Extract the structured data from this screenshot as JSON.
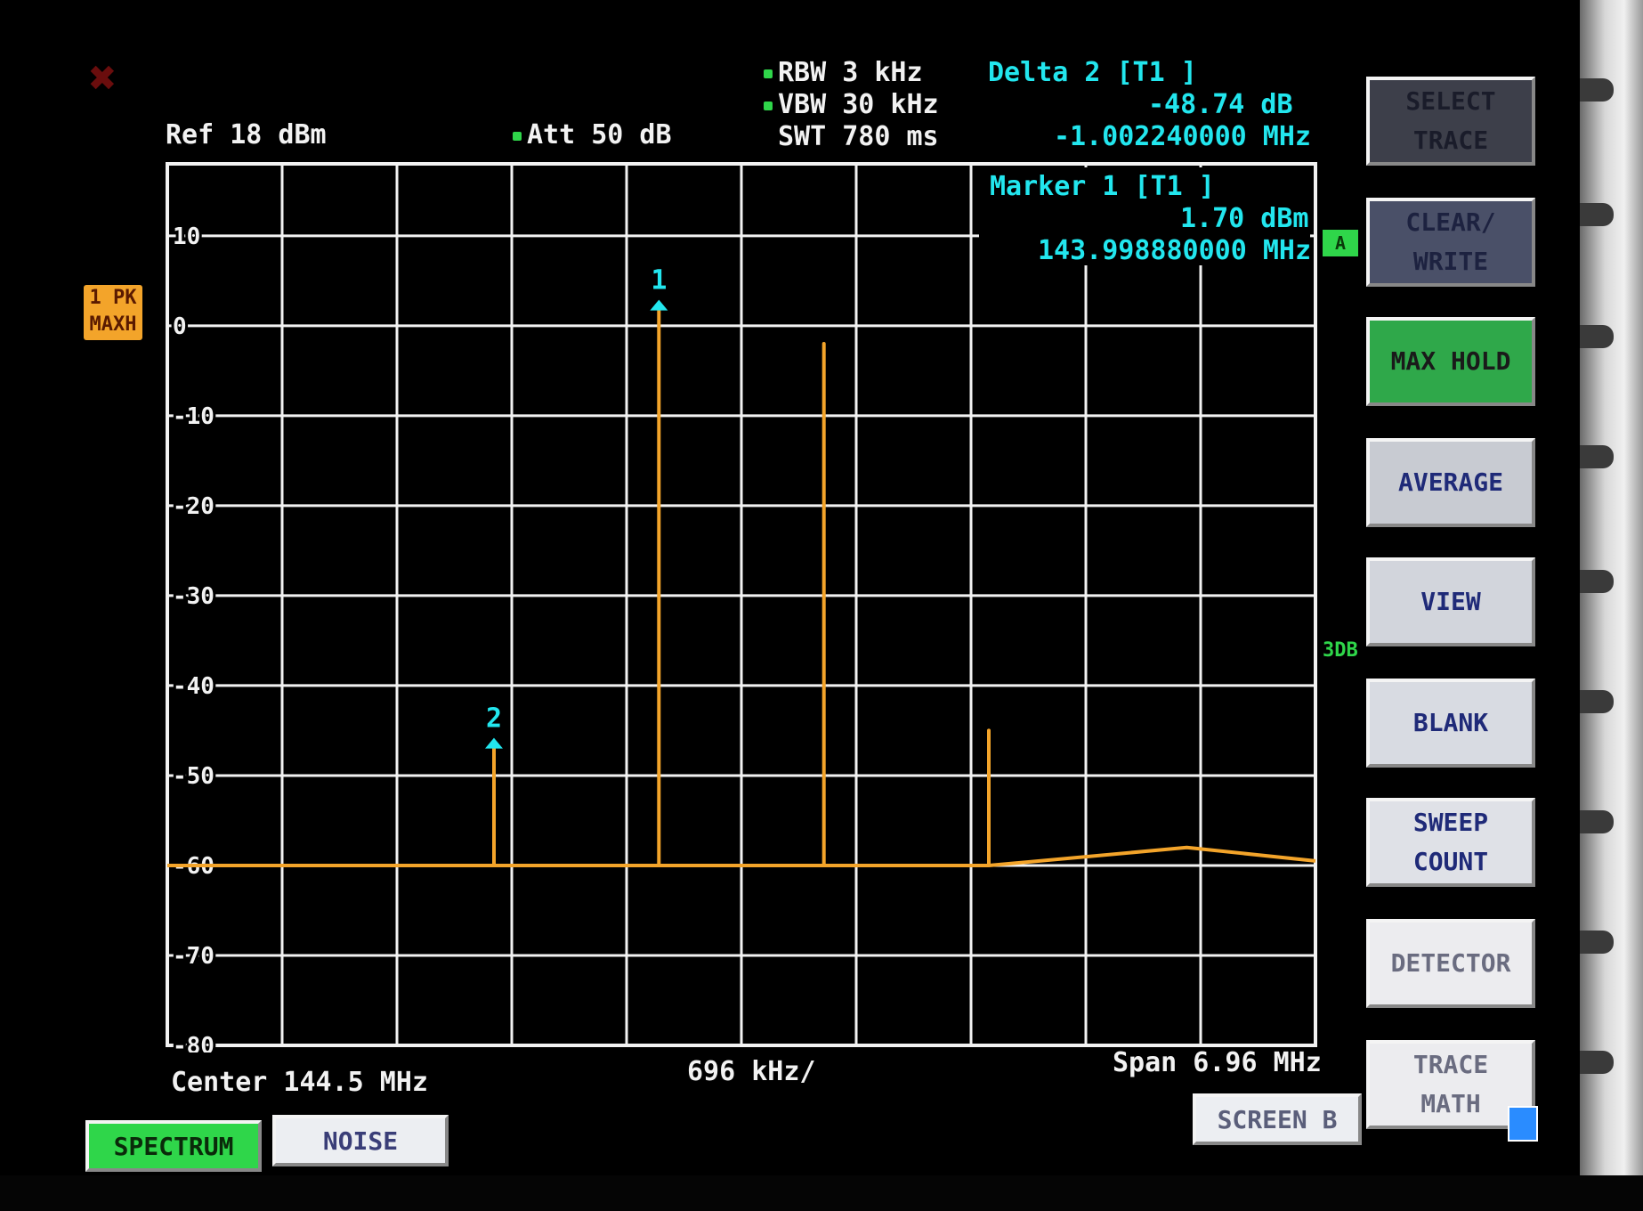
{
  "header": {
    "ref": "Ref  18 dBm",
    "att": "Att  50 dB",
    "rbw": "RBW 3 kHz",
    "vbw": "VBW 30 kHz",
    "swt": "SWT 780 ms"
  },
  "delta_marker": {
    "title": "Delta 2 [T1 ]",
    "level": "-48.74 dB",
    "freq": "-1.002240000 MHz"
  },
  "marker1": {
    "title": "Marker 1 [T1 ]",
    "level": "1.70 dBm",
    "freq": "143.998880000 MHz"
  },
  "chart_data": {
    "type": "line",
    "title": "",
    "xlabel": "",
    "ylabel": "",
    "ylim": [
      -80,
      18
    ],
    "yticks": [
      "10",
      "0",
      "-10",
      "-20",
      "-30",
      "-40",
      "-50",
      "-60",
      "-70",
      "-80"
    ],
    "grid": true,
    "x_axis": {
      "center": "Center 144.5 MHz",
      "per_div": "696 kHz/",
      "span": "Span 6.96 MHz",
      "range_mhz": [
        141.02,
        147.98
      ]
    },
    "series": [
      {
        "x": [
          141.02,
          142.0,
          143.0,
          143.0,
          143.0,
          144.0,
          144.0,
          144.0,
          145.0,
          145.0,
          145.0,
          146.0,
          146.0,
          146.0,
          147.2,
          147.98
        ],
        "y": [
          -60,
          -60,
          -60,
          -47,
          -60,
          -60,
          1.7,
          -60,
          -60,
          -2,
          -60,
          -60,
          -45,
          -60,
          -58,
          -59.5
        ]
      }
    ],
    "markers": [
      {
        "label": "1",
        "x": 144.0,
        "y": 1.7
      },
      {
        "label": "2",
        "x": 143.0,
        "y": -47
      }
    ]
  },
  "trace_badge": {
    "line1": "1 PK",
    "line2": "MAXH"
  },
  "side_badges": {
    "a": "A",
    "three_db": "3DB"
  },
  "softkeys": [
    {
      "line1": "SELECT",
      "line2": "TRACE"
    },
    {
      "line1": "CLEAR/",
      "line2": "WRITE"
    },
    {
      "line1": "MAX HOLD",
      "line2": ""
    },
    {
      "line1": "AVERAGE",
      "line2": ""
    },
    {
      "line1": "VIEW",
      "line2": ""
    },
    {
      "line1": "BLANK",
      "line2": ""
    },
    {
      "line1": "SWEEP",
      "line2": "COUNT"
    },
    {
      "line1": "DETECTOR",
      "line2": ""
    },
    {
      "line1": "TRACE",
      "line2": "MATH"
    }
  ],
  "tabs": {
    "spectrum": "SPECTRUM",
    "noise": "NOISE",
    "screen_b": "SCREEN B"
  },
  "colors": {
    "trace": "#f3a42a",
    "grid": "#f2f2f2",
    "marker_text": "#22e6ee",
    "active_green": "#2fa84a"
  }
}
